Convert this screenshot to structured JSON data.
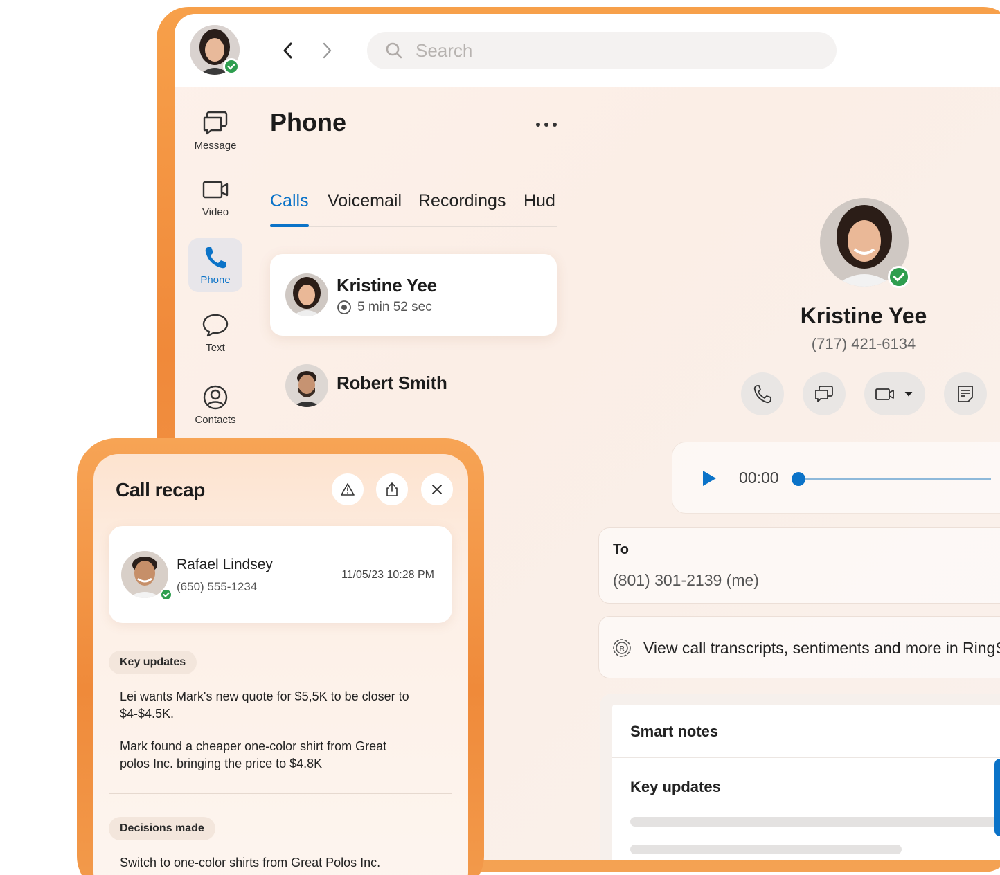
{
  "search": {
    "placeholder": "Search"
  },
  "sidebar": {
    "items": [
      {
        "label": "Message",
        "icon": "message-icon"
      },
      {
        "label": "Video",
        "icon": "video-icon"
      },
      {
        "label": "Phone",
        "icon": "phone-icon"
      },
      {
        "label": "Text",
        "icon": "text-bubble-icon"
      },
      {
        "label": "Contacts",
        "icon": "contacts-icon"
      }
    ]
  },
  "phone": {
    "title": "Phone",
    "tabs": [
      "Calls",
      "Voicemail",
      "Recordings",
      "Hud"
    ],
    "calls": [
      {
        "name": "Kristine Yee",
        "duration": "5 min 52 sec"
      },
      {
        "name": "Robert Smith"
      }
    ]
  },
  "detail": {
    "name": "Kristine Yee",
    "number": "(717) 421-6134",
    "player_time": "00:00",
    "to_label": "To",
    "to_value": "(801) 301-2139 (me)",
    "transcript_text": "View call transcripts, sentiments and more in RingSense",
    "smart_notes_title": "Smart notes",
    "key_updates_title": "Key updates"
  },
  "recap": {
    "title": "Call recap",
    "contact_name": "Rafael Lindsey",
    "contact_phone": "(650) 555-1234",
    "contact_datetime": "11/05/23 10:28 PM",
    "key_updates_label": "Key updates",
    "key_update_1": "Lei wants Mark's new quote for $5,5K to be closer to $4-$4.5K.",
    "key_update_2": "Mark found a cheaper one-color shirt from Great polos Inc. bringing the price to $4.8K",
    "decisions_label": "Decisions made",
    "decision_1": "Switch to one-color shirts from Great Polos Inc."
  },
  "colors": {
    "accent": "#0b73c8",
    "frame_orange": "#f0893a",
    "status_green": "#2e9e4f"
  }
}
